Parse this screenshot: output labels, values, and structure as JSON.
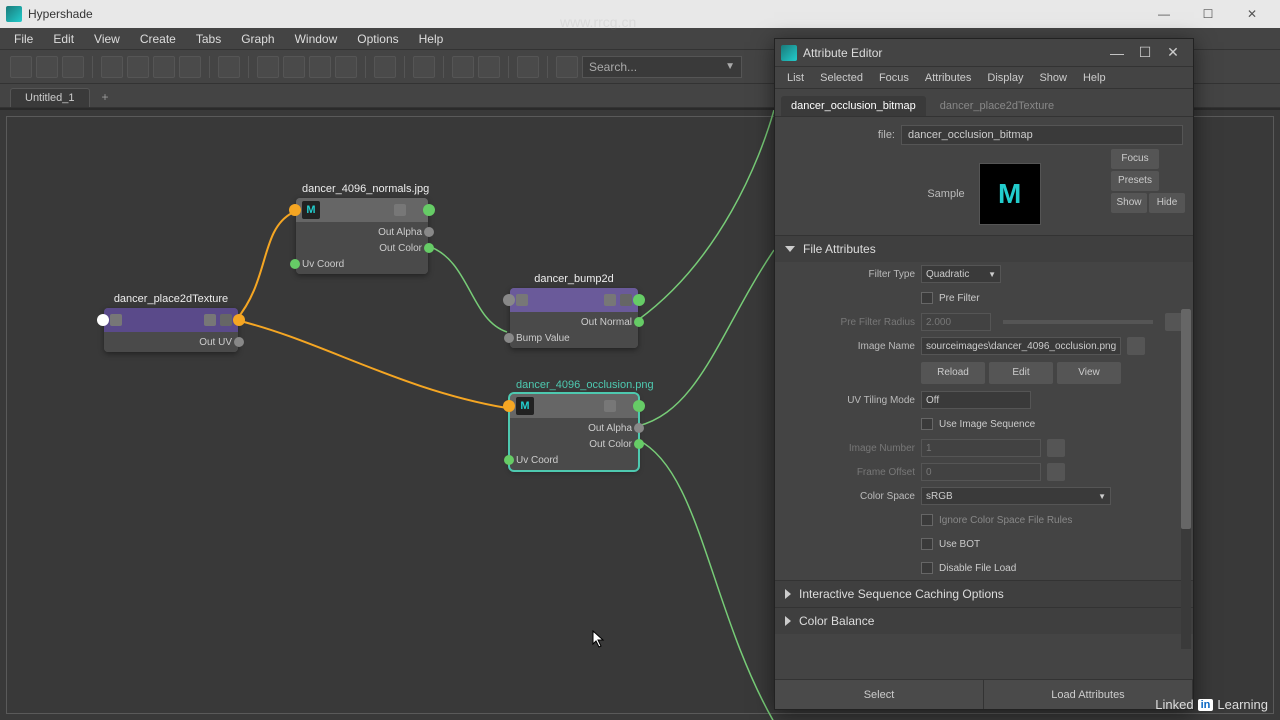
{
  "window": {
    "title": "Hypershade",
    "buttons": {
      "min": "—",
      "max": "☐",
      "close": "✕"
    }
  },
  "menubar": [
    "File",
    "Edit",
    "View",
    "Create",
    "Tabs",
    "Graph",
    "Window",
    "Options",
    "Help"
  ],
  "toolbar": {
    "search_placeholder": "Search..."
  },
  "tabs": {
    "active": "Untitled_1",
    "new": "+"
  },
  "nodes": {
    "place2d": {
      "title": "dancer_place2dTexture",
      "outputs": [
        "Out UV"
      ]
    },
    "normals": {
      "title": "dancer_4096_normals.jpg",
      "outputs": [
        "Out Alpha",
        "Out Color"
      ],
      "inputs": [
        "Uv Coord"
      ]
    },
    "bump2d": {
      "title": "dancer_bump2d",
      "outputs": [
        "Out Normal"
      ],
      "inputs": [
        "Bump Value"
      ]
    },
    "occlusion": {
      "title": "dancer_4096_occlusion.png",
      "outputs": [
        "Out Alpha",
        "Out Color"
      ],
      "inputs": [
        "Uv Coord"
      ]
    }
  },
  "attribute_editor": {
    "title": "Attribute Editor",
    "window_buttons": {
      "min": "—",
      "max": "☐",
      "close": "✕"
    },
    "menubar": [
      "List",
      "Selected",
      "Focus",
      "Attributes",
      "Display",
      "Show",
      "Help"
    ],
    "tabs": [
      {
        "label": "dancer_occlusion_bitmap",
        "active": true
      },
      {
        "label": "dancer_place2dTexture",
        "active": false
      }
    ],
    "side_buttons": {
      "focus": "Focus",
      "presets": "Presets",
      "show": "Show",
      "hide": "Hide"
    },
    "file_label": "file:",
    "file_value": "dancer_occlusion_bitmap",
    "sample_label": "Sample",
    "sections": {
      "file_attributes": {
        "title": "File Attributes",
        "filter_type_label": "Filter Type",
        "filter_type_value": "Quadratic",
        "pre_filter_label": "Pre Filter",
        "pre_filter_radius_label": "Pre Filter Radius",
        "pre_filter_radius_value": "2.000",
        "image_name_label": "Image Name",
        "image_name_value": "sourceimages\\dancer_4096_occlusion.png",
        "buttons": {
          "reload": "Reload",
          "edit": "Edit",
          "view": "View"
        },
        "uv_tiling_label": "UV Tiling Mode",
        "uv_tiling_value": "Off",
        "use_image_sequence_label": "Use Image Sequence",
        "image_number_label": "Image Number",
        "image_number_value": "1",
        "frame_offset_label": "Frame Offset",
        "frame_offset_value": "0",
        "color_space_label": "Color Space",
        "color_space_value": "sRGB",
        "ignore_rules_label": "Ignore Color Space File Rules",
        "use_bot_label": "Use BOT",
        "disable_file_load_label": "Disable File Load"
      },
      "interactive_caching": {
        "title": "Interactive Sequence Caching Options"
      },
      "color_balance": {
        "title": "Color Balance"
      }
    },
    "footer": {
      "select": "Select",
      "load": "Load Attributes"
    }
  },
  "brand": {
    "linked": "Linked",
    "in": "in",
    "learning": "Learning"
  },
  "watermark_url": "www.rrcg.cn"
}
